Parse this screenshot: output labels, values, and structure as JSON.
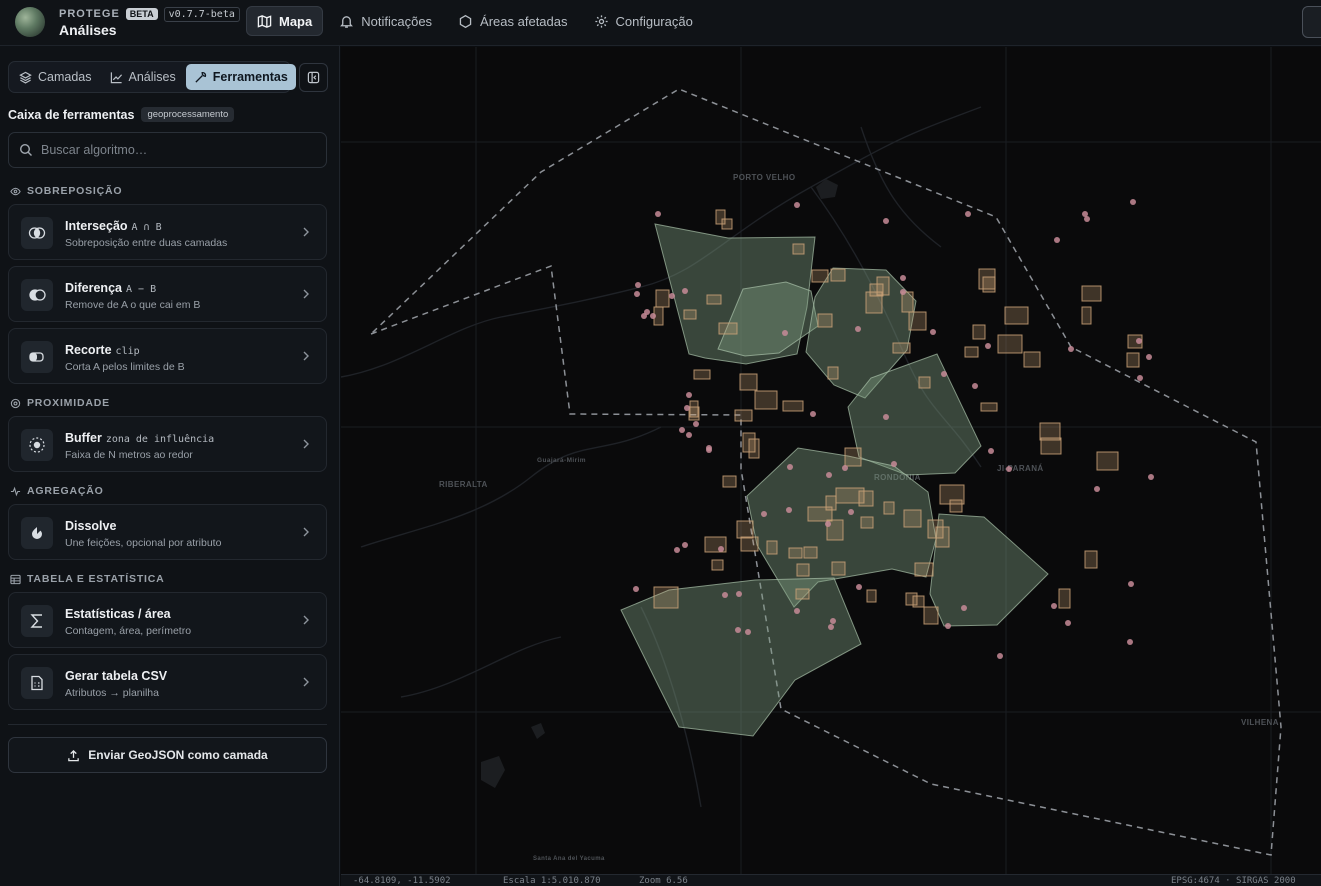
{
  "header": {
    "brand": "PROTEGE",
    "beta": "BETA",
    "version": "v0.7.7-beta",
    "subtitle": "Análises",
    "nav": [
      {
        "label": "Mapa",
        "icon": "map-icon",
        "active": true
      },
      {
        "label": "Notificações",
        "icon": "bell-icon",
        "active": false
      },
      {
        "label": "Áreas afetadas",
        "icon": "circle-icon",
        "active": false
      },
      {
        "label": "Configuração",
        "icon": "gear-icon",
        "active": false
      }
    ]
  },
  "sidebar": {
    "tabs": [
      {
        "label": "Camadas",
        "icon": "layers-icon"
      },
      {
        "label": "Análises",
        "icon": "chart-line-icon"
      },
      {
        "label": "Ferramentas",
        "icon": "wrench-icon",
        "active": true
      }
    ],
    "toolbox_title": "Caixa de ferramentas",
    "toolbox_badge": "geoprocessamento",
    "search_placeholder": "Buscar algoritmo…",
    "sections": {
      "overlay": "SOBREPOSIÇÃO",
      "proximity": "PROXIMIDADE",
      "aggregation": "AGREGAÇÃO",
      "table": "TABELA E ESTATÍSTICA"
    },
    "tools": {
      "intersection": {
        "title": "Interseção",
        "code": "A ∩ B",
        "subtitle": "Sobreposição entre duas camadas"
      },
      "difference": {
        "title": "Diferença",
        "code": "A − B",
        "subtitle": "Remove de A o que cai em B"
      },
      "clip": {
        "title": "Recorte",
        "code": "clip",
        "subtitle": "Corta A pelos limites de B"
      },
      "buffer": {
        "title": "Buffer",
        "code": "zona de influência",
        "subtitle": "Faixa de N metros ao redor"
      },
      "dissolve": {
        "title": "Dissolve",
        "code": "",
        "subtitle": "Une feições, opcional por atributo"
      },
      "stats": {
        "title": "Estatísticas / área",
        "code": "",
        "subtitle": "Contagem, área, perímetro"
      },
      "csv": {
        "title": "Gerar tabela CSV",
        "code": "",
        "subtitle": "Atributos → planilha"
      }
    },
    "upload_label": "Enviar GeoJSON como camada"
  },
  "map": {
    "cities": {
      "porto_velho": "PORTO VELHO",
      "guajara": "Guajará-Mirim",
      "riberalta": "RIBERALTA",
      "rondonia": "RONDÔNIA",
      "ji_parana": "JI-PARANÁ",
      "vilhena": "VILHENA",
      "santa_ana": "Santa Ana del Yacuma"
    },
    "colors": {
      "polygon": "#7d9a7f",
      "square": "#c9a177",
      "dot": "#c78b98",
      "boundary": "#8c9096"
    }
  },
  "status": {
    "coords": "-64.8109, -11.5902",
    "scale": "Escala 1:5.010.870",
    "zoom": "Zoom 6.56",
    "crs": "EPSG:4674 · SIRGAS 2000"
  }
}
